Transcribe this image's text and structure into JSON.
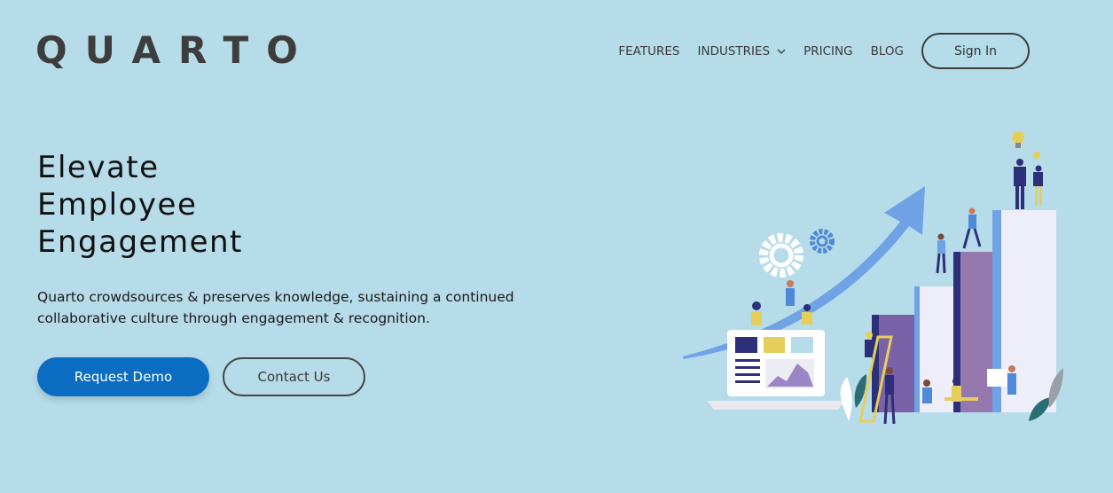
{
  "brand": {
    "logo_text": "QUARTO"
  },
  "nav": {
    "items": [
      {
        "label": "FEATURES"
      },
      {
        "label": "INDUSTRIES"
      },
      {
        "label": "PRICING"
      },
      {
        "label": "BLOG"
      }
    ],
    "signin_label": "Sign In"
  },
  "hero": {
    "title_lines": [
      "Elevate",
      "Employee",
      "Engagement"
    ],
    "description_line1": "Quarto crowdsources & preserves knowledge, sustaining a continued",
    "description_line2": "collaborative culture through engagement & recognition.",
    "primary_button": "Request Demo",
    "secondary_button": "Contact Us"
  },
  "colors": {
    "background": "#b6dbe9",
    "primary": "#0a6dc2",
    "text_dark": "#3d3d3d"
  },
  "icons": [
    "chevron-down-icon",
    "gear-icon",
    "lightbulb-icon",
    "growth-arrow-icon"
  ]
}
